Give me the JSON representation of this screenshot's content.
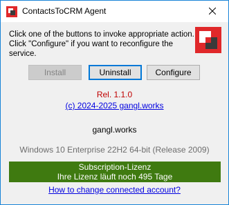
{
  "window": {
    "title": "ContactsToCRM Agent"
  },
  "instructions": {
    "line1": "Click one of the buttons to invoke appropriate action.",
    "line2": "Click \"Configure\" if you want to reconfigure the service."
  },
  "buttons": {
    "install": "Install",
    "uninstall": "Uninstall",
    "configure": "Configure"
  },
  "info": {
    "release": "Rel. 1.1.0",
    "copyright": "(c) 2024-2025  gangl.works",
    "company": "gangl.works",
    "os": "Windows 10 Enterprise 22H2 64-bit (Release 2009)"
  },
  "license": {
    "line1": "Subscription-Lizenz",
    "line2": "Ihre Lizenz läuft noch 495 Tage"
  },
  "links": {
    "change_account": "How to change connected account?"
  },
  "colors": {
    "accent_red": "#e0282a",
    "license_green": "#3f7a10",
    "link_blue": "#0000e0",
    "release_red": "#c00000"
  },
  "icons": {
    "app": "red-squares-app-icon",
    "close": "close-icon",
    "logo": "red-squares-logo"
  }
}
